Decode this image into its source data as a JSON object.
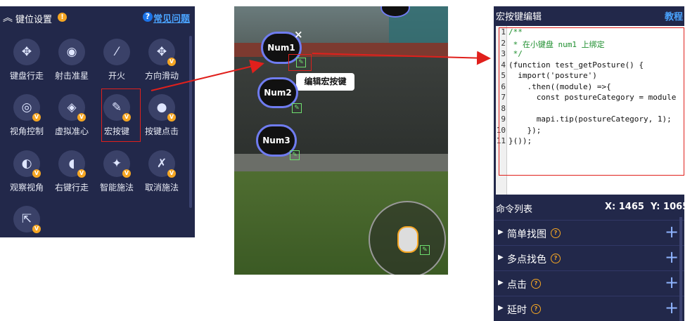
{
  "keypanel": {
    "title": "键位设置",
    "faq": "常见问题",
    "tools": [
      {
        "label": "键盘行走",
        "icon": "dpad-icon",
        "glyph": "✥",
        "vip": false
      },
      {
        "label": "射击准星",
        "icon": "crosshair-icon",
        "glyph": "◉",
        "vip": false
      },
      {
        "label": "开火",
        "icon": "bullet-icon",
        "glyph": "⁄",
        "vip": false
      },
      {
        "label": "方向滑动",
        "icon": "swipe-icon",
        "glyph": "✥",
        "vip": true
      },
      {
        "label": "视角控制",
        "icon": "eye-view-icon",
        "glyph": "◎",
        "vip": true
      },
      {
        "label": "虚拟准心",
        "icon": "virtual-crosshair-icon",
        "glyph": "◈",
        "vip": true
      },
      {
        "label": "宏按键",
        "icon": "macro-script-icon",
        "glyph": "✎",
        "vip": true
      },
      {
        "label": "按键点击",
        "icon": "click-dot-icon",
        "glyph": "●",
        "vip": true
      },
      {
        "label": "观察视角",
        "icon": "observe-eye-icon",
        "glyph": "◐",
        "vip": true
      },
      {
        "label": "右键行走",
        "icon": "right-mouse-icon",
        "glyph": "◖",
        "vip": true
      },
      {
        "label": "智能施法",
        "icon": "magic-wand-icon",
        "glyph": "✦",
        "vip": true
      },
      {
        "label": "取消施法",
        "icon": "cancel-cast-icon",
        "glyph": "✗",
        "vip": true
      },
      {
        "label": "",
        "icon": "export-icon",
        "glyph": "⇱",
        "vip": true
      }
    ],
    "vip_badge": "V"
  },
  "game": {
    "buttons": [
      "Num1",
      "Num2",
      "Num3"
    ],
    "close": "×",
    "tooltip": "编辑宏按键",
    "edit_glyph": "✎"
  },
  "editor": {
    "title": "宏按键编辑",
    "tutorial": "教程",
    "code_lines": [
      "/**",
      " * 在小键盘 num1 上绑定",
      " */",
      "(function test_getPosture() {",
      "  import('posture')",
      "    .then((module) =>{",
      "      const postureCategory = module",
      "",
      "      mapi.tip(postureCategory, 1);",
      "    });",
      "}());"
    ],
    "command_list_title": "命令列表",
    "coord_x_label": "X:",
    "coord_x": "1465",
    "coord_y_label": "Y:",
    "coord_y": "1065",
    "commands": [
      "简单找图",
      "多点找色",
      "点击",
      "延时"
    ],
    "help_glyph": "?",
    "add_glyph": "+"
  },
  "colors": {
    "panel_bg": "#22284a",
    "accent_link": "#4aa3ff",
    "vip_badge": "#f5a623",
    "highlight_red": "#e0201c",
    "num_button_border": "#6f7cf0"
  }
}
